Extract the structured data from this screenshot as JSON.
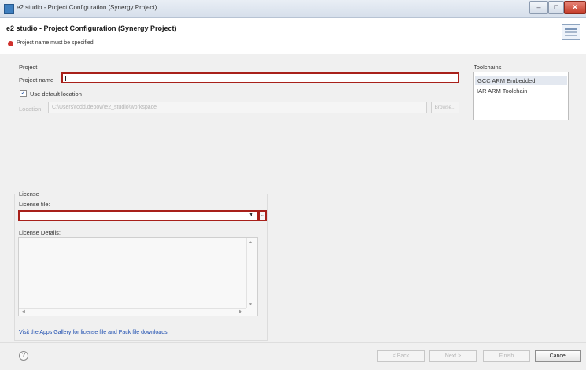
{
  "window": {
    "title": "e2 studio - Project Configuration (Synergy Project)",
    "minimize_glyph": "–",
    "maximize_glyph": "□",
    "close_glyph": "✕"
  },
  "header": {
    "title": "e2 studio - Project Configuration  (Synergy Project)",
    "error_message": "Project name must be specified"
  },
  "project": {
    "group_label": "Project",
    "name_label": "Project name",
    "name_value": "",
    "use_default_checked": true,
    "use_default_label": "Use default location",
    "location_label": "Location:",
    "location_value": "C:\\Users\\todd.debow\\e2_studio\\workspace",
    "browse_label": "Browse..."
  },
  "toolchains": {
    "label": "Toolchains",
    "items": [
      "GCC ARM Embedded",
      "IAR ARM Toolchain"
    ],
    "selected_index": 0
  },
  "license": {
    "group_label": "License",
    "file_label": "License file:",
    "file_value": "",
    "browse_label": "...",
    "details_label": "License Details:",
    "gallery_link": "Visit the Apps Gallery for license file and Pack file downloads"
  },
  "buttons": {
    "help": "?",
    "back": "< Back",
    "next": "Next >",
    "finish": "Finish",
    "cancel": "Cancel"
  },
  "colors": {
    "error_highlight": "#a8201a",
    "link": "#1f4fb0"
  },
  "icons": {
    "app": "e2-studio-app-icon",
    "error": "error-icon",
    "banner": "wizard-banner-icon",
    "help": "help-icon"
  }
}
